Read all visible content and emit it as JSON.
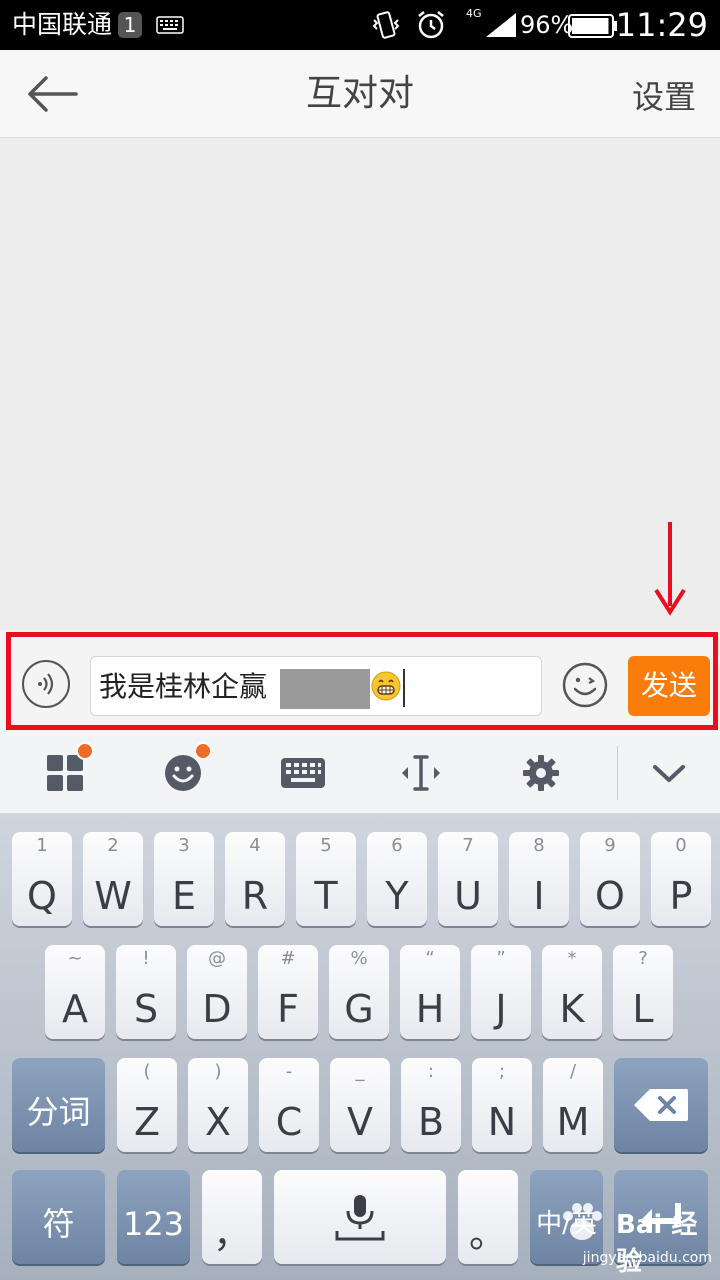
{
  "status_bar": {
    "carrier": "中国联通",
    "sim": "1",
    "network": "4G",
    "battery_pct": "96%",
    "battery_level": 0.96,
    "time": "11:29"
  },
  "header": {
    "title": "互对对",
    "settings_label": "设置"
  },
  "composer": {
    "text": "我是桂林企赢",
    "send_label": "发送"
  },
  "keyboard": {
    "row1": [
      {
        "hint": "1",
        "label": "Q"
      },
      {
        "hint": "2",
        "label": "W"
      },
      {
        "hint": "3",
        "label": "E"
      },
      {
        "hint": "4",
        "label": "R"
      },
      {
        "hint": "5",
        "label": "T"
      },
      {
        "hint": "6",
        "label": "Y"
      },
      {
        "hint": "7",
        "label": "U"
      },
      {
        "hint": "8",
        "label": "I"
      },
      {
        "hint": "9",
        "label": "O"
      },
      {
        "hint": "0",
        "label": "P"
      }
    ],
    "row2": [
      {
        "hint": "~",
        "label": "A"
      },
      {
        "hint": "!",
        "label": "S"
      },
      {
        "hint": "@",
        "label": "D"
      },
      {
        "hint": "#",
        "label": "F"
      },
      {
        "hint": "%",
        "label": "G"
      },
      {
        "hint": "“",
        "label": "H"
      },
      {
        "hint": "”",
        "label": "J"
      },
      {
        "hint": "*",
        "label": "K"
      },
      {
        "hint": "?",
        "label": "L"
      }
    ],
    "row3": [
      {
        "hint": "(",
        "label": "Z"
      },
      {
        "hint": ")",
        "label": "X"
      },
      {
        "hint": "-",
        "label": "C"
      },
      {
        "hint": "_",
        "label": "V"
      },
      {
        "hint": ":",
        "label": "B"
      },
      {
        "hint": ";",
        "label": "N"
      },
      {
        "hint": "/",
        "label": "M"
      }
    ],
    "segment_label": "分词",
    "symbol_label": "符",
    "numbers_label": "123",
    "comma_label": "，",
    "period_label": "。",
    "lang_label": "中/英"
  },
  "watermark": {
    "brand": "Bai 经验",
    "url": "jingyan.baidu.com"
  },
  "colors": {
    "send": "#fa7d0c",
    "highlight": "#e8101f",
    "badge": "#f06a28"
  }
}
